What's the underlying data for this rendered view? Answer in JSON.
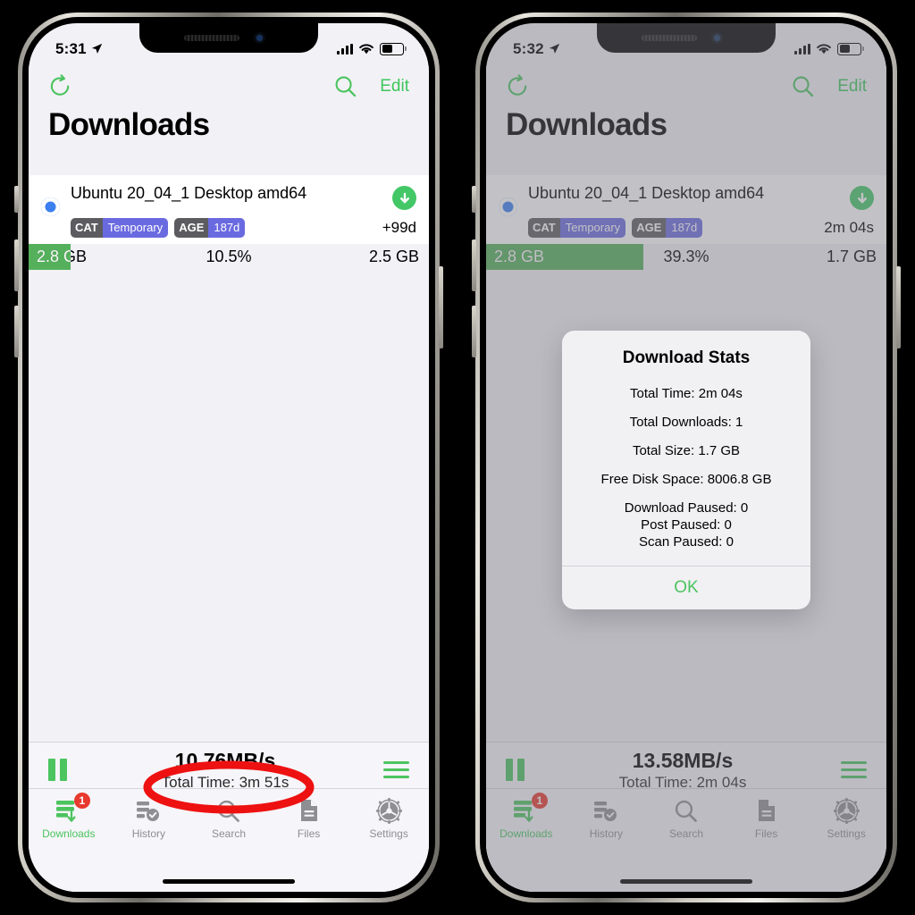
{
  "background_color": "#000000",
  "accent_green": "#4cc45f",
  "badge_red": "#e8392e",
  "tag_purple": "#6a6ae0",
  "phones": [
    {
      "id": "left",
      "status_bar": {
        "time": "5:31",
        "location_icon": "location-arrow-icon",
        "signal_icon": "cellular-bars-icon",
        "wifi_icon": "wifi-icon",
        "battery_icon": "battery-icon"
      },
      "nav": {
        "refresh_icon": "refresh-icon",
        "search_icon": "search-icon",
        "edit_label": "Edit"
      },
      "title": "Downloads",
      "row": {
        "state_icon": "active-circle-icon",
        "name": "Ubuntu 20_04_1 Desktop amd64",
        "download_icon": "download-arrow-icon",
        "eta": "+99d",
        "tags": [
          {
            "key": "CAT",
            "value": "Temporary"
          },
          {
            "key": "AGE",
            "value": "187d"
          }
        ],
        "progress": {
          "size_total": "2.8 GB",
          "percent_label": "10.5%",
          "percent_value": 10.5,
          "downloaded": "2.5 GB"
        }
      },
      "toolbar": {
        "pause_icon": "pause-icon",
        "speed": "10.76MB/s",
        "total_time": "Total Time: 3m 51s",
        "menu_icon": "hamburger-menu-icon"
      },
      "tabs": [
        {
          "label": "Downloads",
          "icon": "downloads-icon",
          "badge": "1",
          "active": true
        },
        {
          "label": "History",
          "icon": "history-icon",
          "active": false
        },
        {
          "label": "Search",
          "icon": "search-icon",
          "active": false
        },
        {
          "label": "Files",
          "icon": "files-icon",
          "active": false
        },
        {
          "label": "Settings",
          "icon": "settings-gear-icon",
          "active": false
        }
      ],
      "dimmed": false,
      "annotation": {
        "shape": "ellipse",
        "color": "#ee1111",
        "target": "Total Time: 3m 51s"
      }
    },
    {
      "id": "right",
      "status_bar": {
        "time": "5:32",
        "location_icon": "location-arrow-icon",
        "signal_icon": "cellular-bars-icon",
        "wifi_icon": "wifi-icon",
        "battery_icon": "battery-icon"
      },
      "nav": {
        "refresh_icon": "refresh-icon",
        "search_icon": "search-icon",
        "edit_label": "Edit"
      },
      "title": "Downloads",
      "row": {
        "state_icon": "active-circle-icon",
        "name": "Ubuntu 20_04_1 Desktop amd64",
        "download_icon": "download-arrow-icon",
        "eta": "2m 04s",
        "tags": [
          {
            "key": "CAT",
            "value": "Temporary"
          },
          {
            "key": "AGE",
            "value": "187d"
          }
        ],
        "progress": {
          "size_total": "2.8 GB",
          "percent_label": "39.3%",
          "percent_value": 39.3,
          "downloaded": "1.7 GB"
        }
      },
      "toolbar": {
        "pause_icon": "pause-icon",
        "speed": "13.58MB/s",
        "total_time": "Total Time: 2m 04s",
        "menu_icon": "hamburger-menu-icon"
      },
      "tabs": [
        {
          "label": "Downloads",
          "icon": "downloads-icon",
          "badge": "1",
          "active": true
        },
        {
          "label": "History",
          "icon": "history-icon",
          "active": false
        },
        {
          "label": "Search",
          "icon": "search-icon",
          "active": false
        },
        {
          "label": "Files",
          "icon": "files-icon",
          "active": false
        },
        {
          "label": "Settings",
          "icon": "settings-gear-icon",
          "active": false
        }
      ],
      "dimmed": true,
      "dialog": {
        "title": "Download Stats",
        "lines": [
          "Total Time: 2m 04s",
          "Total Downloads: 1",
          "Total Size: 1.7 GB",
          "Free Disk Space: 8006.8 GB"
        ],
        "group": [
          "Download Paused: 0",
          "Post Paused: 0",
          "Scan Paused: 0"
        ],
        "ok_label": "OK"
      }
    }
  ]
}
